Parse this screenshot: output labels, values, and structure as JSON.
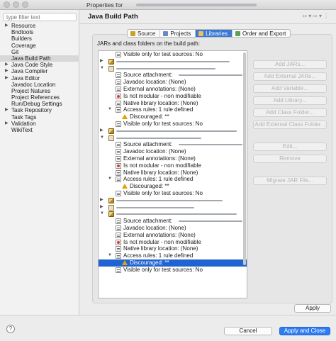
{
  "window": {
    "title": "Properties for"
  },
  "sidebar": {
    "filter_placeholder": "type filter text",
    "items": [
      {
        "label": "Resource",
        "expandable": true
      },
      {
        "label": "Bndtools",
        "expandable": false
      },
      {
        "label": "Builders",
        "expandable": false
      },
      {
        "label": "Coverage",
        "expandable": false
      },
      {
        "label": "Git",
        "expandable": false
      },
      {
        "label": "Java Build Path",
        "expandable": false,
        "selected": true
      },
      {
        "label": "Java Code Style",
        "expandable": true
      },
      {
        "label": "Java Compiler",
        "expandable": true
      },
      {
        "label": "Java Editor",
        "expandable": true
      },
      {
        "label": "Javadoc Location",
        "expandable": false
      },
      {
        "label": "Project Natures",
        "expandable": false
      },
      {
        "label": "Project References",
        "expandable": false
      },
      {
        "label": "Run/Debug Settings",
        "expandable": false
      },
      {
        "label": "Task Repository",
        "expandable": true
      },
      {
        "label": "Task Tags",
        "expandable": false
      },
      {
        "label": "Validation",
        "expandable": true
      },
      {
        "label": "WikiText",
        "expandable": false
      }
    ]
  },
  "header": {
    "title": "Java Build Path"
  },
  "tabs": [
    {
      "label": "Source",
      "icon": "source-folder-icon",
      "color": "#c9a227"
    },
    {
      "label": "Projects",
      "icon": "projects-icon",
      "color": "#6b86c9"
    },
    {
      "label": "Libraries",
      "icon": "libraries-icon",
      "color": "#e7c35a",
      "active": true
    },
    {
      "label": "Order and Export",
      "icon": "order-export-icon",
      "color": "#5aa05a"
    }
  ],
  "libraries": {
    "heading": "JARs and class folders on the build path:",
    "tree": [
      {
        "text": "Visible only for test sources: No",
        "icon": "attribute-icon",
        "level": 2
      },
      {
        "text": "",
        "icon": "jar-icon",
        "level": 1,
        "collapsed": true
      },
      {
        "text": "",
        "icon": "jar-icon",
        "level": 1,
        "expanded": true
      },
      {
        "text": "Source attachment:",
        "icon": "attribute-icon",
        "level": 2
      },
      {
        "text": "Javadoc location: (None)",
        "icon": "attribute-icon",
        "level": 2
      },
      {
        "text": "External annotations: (None)",
        "icon": "attribute-icon",
        "level": 2
      },
      {
        "text": "Is not modular - non modifiable",
        "icon": "module-icon",
        "level": 2
      },
      {
        "text": "Native library location: (None)",
        "icon": "attribute-icon",
        "level": 2
      },
      {
        "text": "Access rules: 1 rule defined",
        "icon": "rules-icon",
        "level": 2,
        "expanded": true
      },
      {
        "text": "Discouraged: **",
        "icon": "warning-icon",
        "level": 3
      },
      {
        "text": "Visible only for test sources: No",
        "icon": "attribute-icon",
        "level": 2
      },
      {
        "text": "",
        "icon": "jar-icon",
        "level": 1,
        "collapsed": true
      },
      {
        "text": "",
        "icon": "jar-icon",
        "level": 1,
        "expanded": true
      },
      {
        "text": "Source attachment:",
        "icon": "attribute-icon",
        "level": 2
      },
      {
        "text": "Javadoc location: (None)",
        "icon": "attribute-icon",
        "level": 2
      },
      {
        "text": "External annotations: (None)",
        "icon": "attribute-icon",
        "level": 2
      },
      {
        "text": "Is not modular - non modifiable",
        "icon": "module-icon",
        "level": 2
      },
      {
        "text": "Native library location: (None)",
        "icon": "attribute-icon",
        "level": 2
      },
      {
        "text": "Access rules: 1 rule defined",
        "icon": "rules-icon",
        "level": 2,
        "expanded": true
      },
      {
        "text": "Discouraged: **",
        "icon": "warning-icon",
        "level": 3
      },
      {
        "text": "Visible only for test sources: No",
        "icon": "attribute-icon",
        "level": 2
      },
      {
        "text": "",
        "icon": "jar-icon",
        "level": 1,
        "collapsed": true
      },
      {
        "text": "",
        "icon": "jar-icon",
        "level": 1,
        "collapsed": true
      },
      {
        "text": "",
        "icon": "jar-icon",
        "level": 1,
        "expanded": true
      },
      {
        "text": "Source attachment:",
        "icon": "attribute-icon",
        "level": 2
      },
      {
        "text": "Javadoc location: (None)",
        "icon": "attribute-icon",
        "level": 2
      },
      {
        "text": "External annotations: (None)",
        "icon": "attribute-icon",
        "level": 2
      },
      {
        "text": "Is not modular - non modifiable",
        "icon": "module-icon",
        "level": 2
      },
      {
        "text": "Native library location: (None)",
        "icon": "attribute-icon",
        "level": 2
      },
      {
        "text": "Access rules: 1 rule defined",
        "icon": "rules-icon",
        "level": 2,
        "expanded": true
      },
      {
        "text": "Discouraged: **",
        "icon": "warning-icon",
        "level": 3,
        "selected": true
      },
      {
        "text": "Visible only for test sources: No",
        "icon": "attribute-icon",
        "level": 2
      }
    ],
    "buttons": [
      {
        "label": "Add JARs...",
        "name": "add-jars-button"
      },
      {
        "label": "Add External JARs...",
        "name": "add-external-jars-button"
      },
      {
        "label": "Add Variable...",
        "name": "add-variable-button"
      },
      {
        "label": "Add Library...",
        "name": "add-library-button"
      },
      {
        "label": "Add Class Folder...",
        "name": "add-class-folder-button"
      },
      {
        "label": "Add External Class Folder...",
        "name": "add-external-class-folder-button"
      },
      {
        "label": "Edit...",
        "name": "edit-button"
      },
      {
        "label": "Remove",
        "name": "remove-button"
      },
      {
        "label": "Migrate JAR File...",
        "name": "migrate-jar-button"
      }
    ]
  },
  "actions": {
    "apply": "Apply",
    "cancel": "Cancel",
    "apply_close": "Apply and Close",
    "help": "?"
  }
}
